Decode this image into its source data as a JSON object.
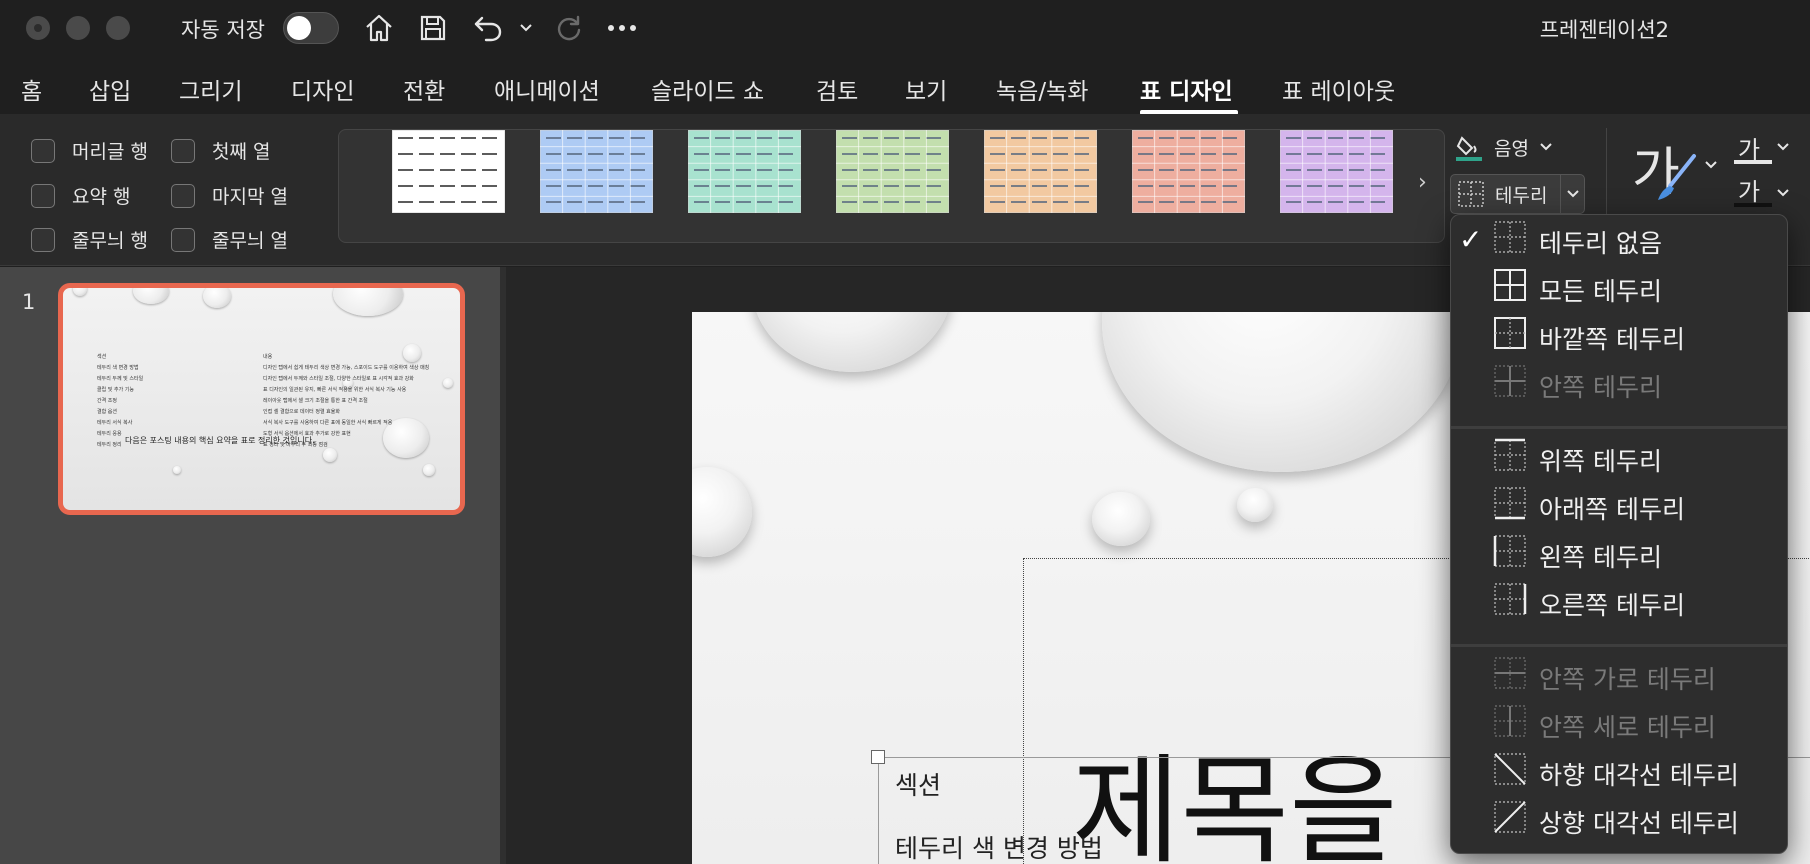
{
  "titlebar": {
    "autosave_label": "자동 저장",
    "doc_title": "프레젠테이션2"
  },
  "tabs": [
    {
      "label": "홈"
    },
    {
      "label": "삽입"
    },
    {
      "label": "그리기"
    },
    {
      "label": "디자인"
    },
    {
      "label": "전환"
    },
    {
      "label": "애니메이션"
    },
    {
      "label": "슬라이드 쇼"
    },
    {
      "label": "검토"
    },
    {
      "label": "보기"
    },
    {
      "label": "녹음/녹화"
    },
    {
      "label": "표 디자인"
    },
    {
      "label": "표 레이아웃"
    }
  ],
  "ribbon": {
    "options": [
      {
        "label": "머리글 행"
      },
      {
        "label": "첫째 열"
      },
      {
        "label": "요약 행"
      },
      {
        "label": "마지막 열"
      },
      {
        "label": "줄무늬 행"
      },
      {
        "label": "줄무늬 열"
      }
    ],
    "styles": [
      {
        "color": "#ffffff"
      },
      {
        "color": "#aecbf4"
      },
      {
        "color": "#a8e2cf"
      },
      {
        "color": "#c3dfae"
      },
      {
        "color": "#f2c9a1"
      },
      {
        "color": "#eeae9f"
      },
      {
        "color": "#d4b5ec"
      }
    ],
    "shading_label": "음영",
    "border_label": "테두리",
    "ga_big": "가",
    "ga_small_top": "가",
    "ga_small_bottom": "가"
  },
  "thumbnail": {
    "slide_number": "1",
    "left_col": [
      "섹션",
      "테두리 색 변경 방법",
      "테두리 두께 및 스타일",
      "클립 및 추가 기능",
      "간격 조정",
      "결합 옵션",
      "테두리 서식 복사",
      "테두리 응용",
      "테두리 정리"
    ],
    "right_col": [
      "내용",
      "디자인 탭에서 쉽게 테두리 색상 변경 가능, 스포이드 도구를 이용하여 색상 매칭",
      "디자인 탭에서 두께와 스타일 조절, 다양한 스타일로 표 시각적 효과 강화",
      "표 디자인의 일관된 유지, 빠른 서식 적용을 위한 서식 복사 기능 사용",
      "레이아웃 탭에서 셀 크기 조절을 통한 표 간격 조절",
      "인접 셀 결합으로 데이터 정렬 효율화",
      "서식 복사 도구를 사용하여 다른 표에 동일한 서식 빠르게 적용",
      "도형 서식 옵션에서 효과 추가로 강한 표현",
      "표 정리 및 마무리 후 최종 점검"
    ],
    "caption": "다음은 포스팅 내용의 핵심 요약을 표로 정리한 것입니다."
  },
  "slide": {
    "cell1": "섹션",
    "cell2": "테두리 색 변경 방법",
    "title": "제목을"
  },
  "border_menu": {
    "items": [
      {
        "label": "테두리 없음",
        "checked": true,
        "disabled": false,
        "icon": "no-border-icon"
      },
      {
        "label": "모든 테두리",
        "checked": false,
        "disabled": false,
        "icon": "all-borders-icon"
      },
      {
        "label": "바깥쪽 테두리",
        "checked": false,
        "disabled": false,
        "icon": "outside-borders-icon"
      },
      {
        "label": "안쪽 테두리",
        "checked": false,
        "disabled": true,
        "icon": "inside-borders-icon"
      },
      {
        "label": "위쪽 테두리",
        "checked": false,
        "disabled": false,
        "icon": "top-border-icon"
      },
      {
        "label": "아래쪽 테두리",
        "checked": false,
        "disabled": false,
        "icon": "bottom-border-icon"
      },
      {
        "label": "왼쪽 테두리",
        "checked": false,
        "disabled": false,
        "icon": "left-border-icon"
      },
      {
        "label": "오른쪽 테두리",
        "checked": false,
        "disabled": false,
        "icon": "right-border-icon"
      },
      {
        "label": "안쪽 가로 테두리",
        "checked": false,
        "disabled": true,
        "icon": "inside-horizontal-border-icon"
      },
      {
        "label": "안쪽 세로 테두리",
        "checked": false,
        "disabled": true,
        "icon": "inside-vertical-border-icon"
      },
      {
        "label": "하향 대각선 테두리",
        "checked": false,
        "disabled": false,
        "icon": "diagonal-down-border-icon"
      },
      {
        "label": "상향 대각선 테두리",
        "checked": false,
        "disabled": false,
        "icon": "diagonal-up-border-icon"
      }
    ]
  }
}
